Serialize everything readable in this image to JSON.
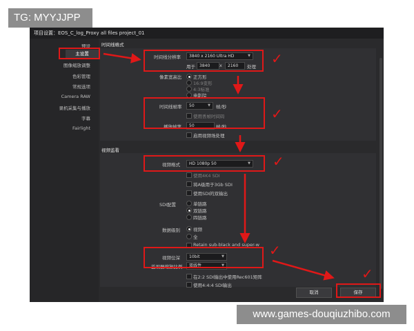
{
  "watermark_top": "TG: MYYJJPP",
  "watermark_bottom": "www.games-douqiuzhibo.com",
  "window_title": "项目设置：EOS_C_log_Proxy all files project_01",
  "sidebar": {
    "items": [
      {
        "label": "预设"
      },
      {
        "label": "主设置",
        "active": true
      },
      {
        "label": "图像缩放调整"
      },
      {
        "label": "色彩管理"
      },
      {
        "label": "常规选项"
      },
      {
        "label": "Camera RAW"
      },
      {
        "label": "录机采集与播放"
      },
      {
        "label": "字幕"
      },
      {
        "label": "Fairlight"
      }
    ]
  },
  "timeline_format": {
    "section": "时间线格式",
    "resolution_label": "时间线分辨率",
    "resolution_value": "3840 x 2160 Ultra HD",
    "use_label": "用于",
    "width": "3840",
    "x": "x",
    "height": "2160",
    "processing": "处理",
    "aspect_label": "像素宽高比",
    "aspect_options": [
      "正方形",
      "16:9变形",
      "4:3标准",
      "电影院"
    ],
    "framerate_label": "时间线帧率",
    "framerate_value": "50",
    "fps_unit": "帧/秒",
    "dropframe_label": "使用丢帧时间码",
    "playback_label": "播放帧率",
    "playback_value": "50",
    "interlace_label": "启用视频场处理"
  },
  "video_monitoring": {
    "section": "视频监看",
    "format_label": "视频格式",
    "format_value": "HD 1080p 50",
    "opt_4k": "使用4K4 SDI",
    "opt_3g": "将A级用于3Gb SDI",
    "opt_dual": "使用SDI的双输出",
    "sdi_label": "SDI配置",
    "sdi_options": [
      "单链路",
      "双链路",
      "四链路"
    ],
    "data_label": "数据级别",
    "data_options": [
      "视频",
      "全"
    ],
    "retain_label": "Retain sub-black and super-w",
    "bitdepth_label": "视频位深",
    "bitdepth_value": "10bit",
    "scaling_label": "监视器缩放比例",
    "scaling_value": "双线性",
    "rec601_label": "在2:2 SDI输出中使用Rec601矩阵",
    "extra_label": "使用4:4:4 SDI输出"
  },
  "buttons": {
    "cancel": "取消",
    "save": "保存"
  },
  "colors": {
    "annotation_red": "#e01818",
    "panel_bg": "#2a2a2c"
  }
}
